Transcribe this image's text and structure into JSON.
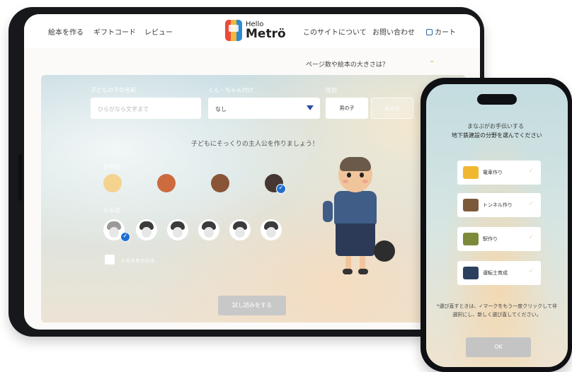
{
  "nav": {
    "items": [
      "絵本を作る",
      "ギフトコード",
      "レビュー",
      "このサイトについて",
      "お問い合わせ",
      "カート"
    ],
    "logo_hello": "Hello",
    "logo_metro": "Metrö"
  },
  "page_size_label": "ページ数や絵本の大きさは？",
  "form": {
    "name_label": "子どもの下の名前",
    "name_placeholder": "ひらがなら文字まで",
    "suffix_label": "くん・ちゃん付け",
    "suffix_value": "なし",
    "gender_label": "性別",
    "gender_options": [
      "男の子",
      "女の子"
    ],
    "headline": "子どもにそっくりの主人公を作りましょう！",
    "hair_color_label": "かみ色",
    "hair_colors": [
      "#f4d38f",
      "#cd6b3f",
      "#8a5436",
      "#453731"
    ],
    "selected_hair_color_index": 3,
    "hair_style_label": "かみ型",
    "selected_hair_style_index": 0,
    "glasses_label": "メガネをかける",
    "try_button": "試し読みをする"
  },
  "phone": {
    "line1": "まなぶがお手伝いする",
    "line2": "地下鉄建設の分野を選んでください",
    "options": [
      "電車作り",
      "トンネル作り",
      "駅作り",
      "運転士育成"
    ],
    "note": "*選び直すときは、✓マークをもう一度クリックして非選択にし、新しく選び直してください。",
    "ok": "OK"
  }
}
